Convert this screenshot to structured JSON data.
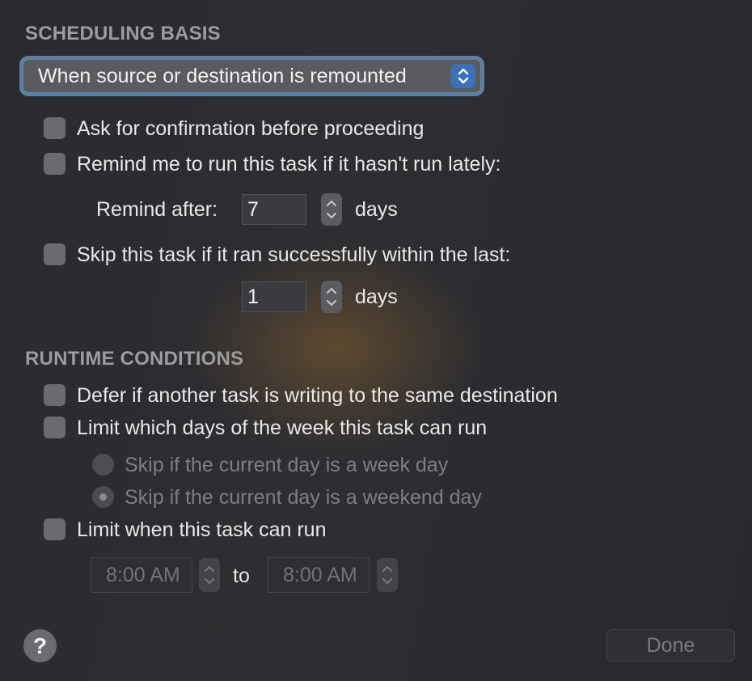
{
  "scheduling": {
    "header": "SCHEDULING BASIS",
    "basis_select": "When source or destination is remounted",
    "ask_confirmation": "Ask for confirmation before proceeding",
    "remind_label": "Remind me to run this task if it hasn't run lately:",
    "remind_after_label": "Remind after:",
    "remind_after_value": "7",
    "remind_unit": "days",
    "skip_label": "Skip this task if it ran successfully within the last:",
    "skip_value": "1",
    "skip_unit": "days"
  },
  "runtime": {
    "header": "RUNTIME CONDITIONS",
    "defer_label": "Defer if another task is writing to the same destination",
    "limit_days_label": "Limit which days of the week this task can run",
    "skip_weekday": "Skip if the current day is a week day",
    "skip_weekend": "Skip if the current day is a weekend day",
    "selected_option": "Skip if the current day is a weekend day",
    "limit_time_label": "Limit when this task can run",
    "time_from": "8:00 AM",
    "time_to_label": "to",
    "time_to": "8:00 AM"
  },
  "footer": {
    "help": "?",
    "done": "Done"
  },
  "colors": {
    "accent": "#3c70b7",
    "focus_ring": "#5d7fa3"
  }
}
